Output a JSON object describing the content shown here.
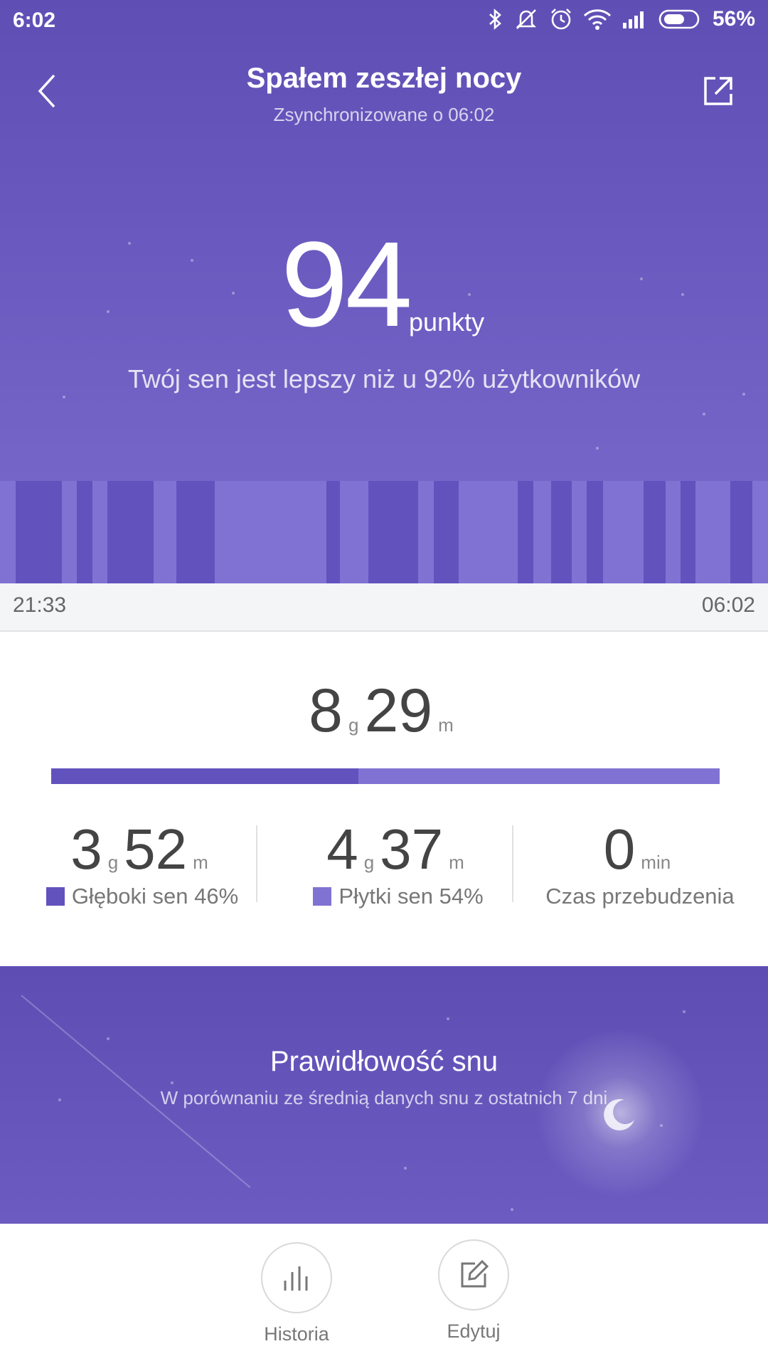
{
  "status_bar": {
    "time": "6:02",
    "battery": "56%"
  },
  "header": {
    "title": "Spałem zeszłej nocy",
    "subtitle": "Zsynchronizowane o 06:02"
  },
  "score": {
    "value": "94",
    "unit": "punkty",
    "comparison": "Twój sen jest lepszy niż u 92% użytkowników"
  },
  "timeline": {
    "start": "21:33",
    "end": "06:02"
  },
  "sleep_stages": [
    {
      "type": "deep",
      "start": 0.02,
      "end": 0.08
    },
    {
      "type": "deep",
      "start": 0.1,
      "end": 0.12
    },
    {
      "type": "deep",
      "start": 0.14,
      "end": 0.2
    },
    {
      "type": "deep",
      "start": 0.23,
      "end": 0.28
    },
    {
      "type": "deep",
      "start": 0.425,
      "end": 0.443
    },
    {
      "type": "deep",
      "start": 0.48,
      "end": 0.545
    },
    {
      "type": "deep",
      "start": 0.565,
      "end": 0.597
    },
    {
      "type": "deep",
      "start": 0.674,
      "end": 0.694
    },
    {
      "type": "deep",
      "start": 0.718,
      "end": 0.745
    },
    {
      "type": "deep",
      "start": 0.764,
      "end": 0.785
    },
    {
      "type": "deep",
      "start": 0.838,
      "end": 0.867
    },
    {
      "type": "deep",
      "start": 0.886,
      "end": 0.905
    },
    {
      "type": "deep",
      "start": 0.951,
      "end": 0.98
    }
  ],
  "summary": {
    "total_hours": "8",
    "total_minutes": "29",
    "hour_unit": "g",
    "minute_unit": "m",
    "deep_fraction": 0.46,
    "deep": {
      "hours": "3",
      "minutes": "52",
      "label": "Głęboki sen 46%"
    },
    "light": {
      "hours": "4",
      "minutes": "37",
      "label": "Płytki sen 54%"
    },
    "awake": {
      "value": "0",
      "unit": "min",
      "label": "Czas przebudzenia"
    }
  },
  "regularity": {
    "title": "Prawidłowość snu",
    "subtitle": "W porównaniu ze średnią danych snu z ostatnich 7 dni"
  },
  "actions": {
    "history_label": "Historia",
    "edit_label": "Edytuj"
  },
  "colors": {
    "deep": "#6252bd",
    "light": "#8072d2",
    "hero": "#5f4fb5"
  },
  "icons": {
    "back": "chevron-left-icon",
    "share": "share-icon",
    "history": "bar-chart-icon",
    "edit": "edit-icon"
  }
}
